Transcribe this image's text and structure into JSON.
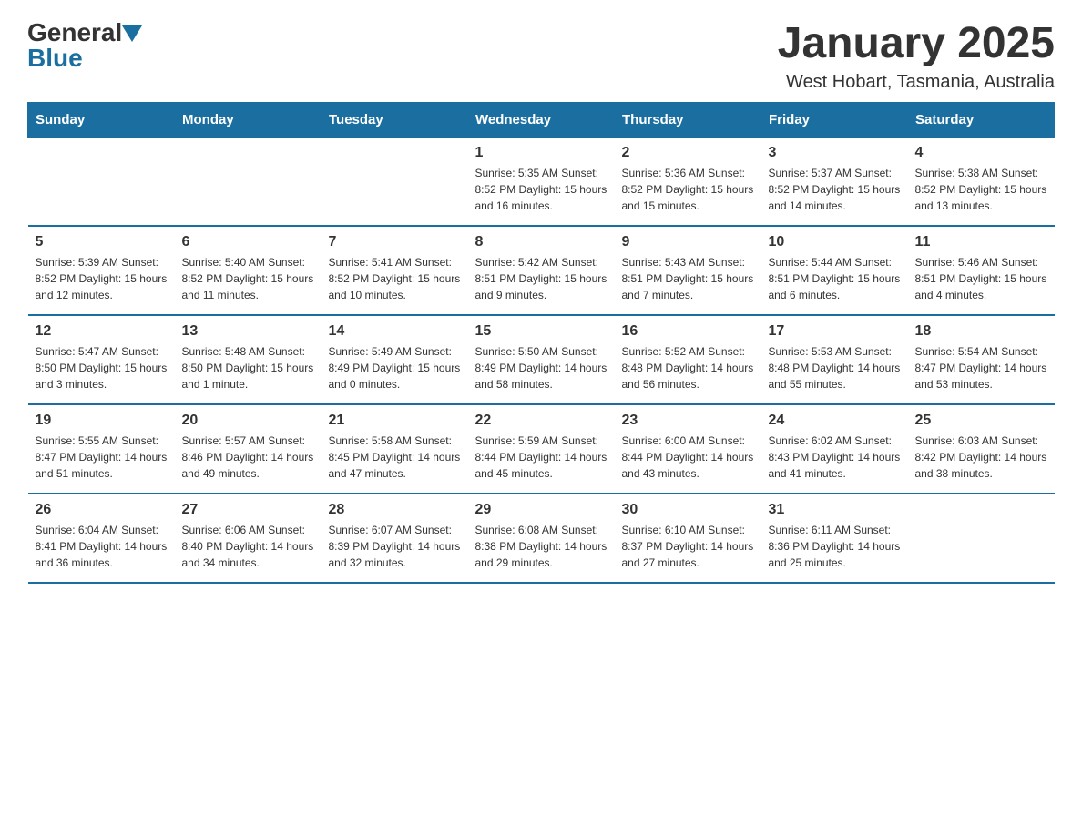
{
  "logo": {
    "general": "General",
    "blue": "Blue"
  },
  "title": "January 2025",
  "location": "West Hobart, Tasmania, Australia",
  "days_of_week": [
    "Sunday",
    "Monday",
    "Tuesday",
    "Wednesday",
    "Thursday",
    "Friday",
    "Saturday"
  ],
  "weeks": [
    [
      {
        "day": "",
        "info": ""
      },
      {
        "day": "",
        "info": ""
      },
      {
        "day": "",
        "info": ""
      },
      {
        "day": "1",
        "info": "Sunrise: 5:35 AM\nSunset: 8:52 PM\nDaylight: 15 hours and 16 minutes."
      },
      {
        "day": "2",
        "info": "Sunrise: 5:36 AM\nSunset: 8:52 PM\nDaylight: 15 hours and 15 minutes."
      },
      {
        "day": "3",
        "info": "Sunrise: 5:37 AM\nSunset: 8:52 PM\nDaylight: 15 hours and 14 minutes."
      },
      {
        "day": "4",
        "info": "Sunrise: 5:38 AM\nSunset: 8:52 PM\nDaylight: 15 hours and 13 minutes."
      }
    ],
    [
      {
        "day": "5",
        "info": "Sunrise: 5:39 AM\nSunset: 8:52 PM\nDaylight: 15 hours and 12 minutes."
      },
      {
        "day": "6",
        "info": "Sunrise: 5:40 AM\nSunset: 8:52 PM\nDaylight: 15 hours and 11 minutes."
      },
      {
        "day": "7",
        "info": "Sunrise: 5:41 AM\nSunset: 8:52 PM\nDaylight: 15 hours and 10 minutes."
      },
      {
        "day": "8",
        "info": "Sunrise: 5:42 AM\nSunset: 8:51 PM\nDaylight: 15 hours and 9 minutes."
      },
      {
        "day": "9",
        "info": "Sunrise: 5:43 AM\nSunset: 8:51 PM\nDaylight: 15 hours and 7 minutes."
      },
      {
        "day": "10",
        "info": "Sunrise: 5:44 AM\nSunset: 8:51 PM\nDaylight: 15 hours and 6 minutes."
      },
      {
        "day": "11",
        "info": "Sunrise: 5:46 AM\nSunset: 8:51 PM\nDaylight: 15 hours and 4 minutes."
      }
    ],
    [
      {
        "day": "12",
        "info": "Sunrise: 5:47 AM\nSunset: 8:50 PM\nDaylight: 15 hours and 3 minutes."
      },
      {
        "day": "13",
        "info": "Sunrise: 5:48 AM\nSunset: 8:50 PM\nDaylight: 15 hours and 1 minute."
      },
      {
        "day": "14",
        "info": "Sunrise: 5:49 AM\nSunset: 8:49 PM\nDaylight: 15 hours and 0 minutes."
      },
      {
        "day": "15",
        "info": "Sunrise: 5:50 AM\nSunset: 8:49 PM\nDaylight: 14 hours and 58 minutes."
      },
      {
        "day": "16",
        "info": "Sunrise: 5:52 AM\nSunset: 8:48 PM\nDaylight: 14 hours and 56 minutes."
      },
      {
        "day": "17",
        "info": "Sunrise: 5:53 AM\nSunset: 8:48 PM\nDaylight: 14 hours and 55 minutes."
      },
      {
        "day": "18",
        "info": "Sunrise: 5:54 AM\nSunset: 8:47 PM\nDaylight: 14 hours and 53 minutes."
      }
    ],
    [
      {
        "day": "19",
        "info": "Sunrise: 5:55 AM\nSunset: 8:47 PM\nDaylight: 14 hours and 51 minutes."
      },
      {
        "day": "20",
        "info": "Sunrise: 5:57 AM\nSunset: 8:46 PM\nDaylight: 14 hours and 49 minutes."
      },
      {
        "day": "21",
        "info": "Sunrise: 5:58 AM\nSunset: 8:45 PM\nDaylight: 14 hours and 47 minutes."
      },
      {
        "day": "22",
        "info": "Sunrise: 5:59 AM\nSunset: 8:44 PM\nDaylight: 14 hours and 45 minutes."
      },
      {
        "day": "23",
        "info": "Sunrise: 6:00 AM\nSunset: 8:44 PM\nDaylight: 14 hours and 43 minutes."
      },
      {
        "day": "24",
        "info": "Sunrise: 6:02 AM\nSunset: 8:43 PM\nDaylight: 14 hours and 41 minutes."
      },
      {
        "day": "25",
        "info": "Sunrise: 6:03 AM\nSunset: 8:42 PM\nDaylight: 14 hours and 38 minutes."
      }
    ],
    [
      {
        "day": "26",
        "info": "Sunrise: 6:04 AM\nSunset: 8:41 PM\nDaylight: 14 hours and 36 minutes."
      },
      {
        "day": "27",
        "info": "Sunrise: 6:06 AM\nSunset: 8:40 PM\nDaylight: 14 hours and 34 minutes."
      },
      {
        "day": "28",
        "info": "Sunrise: 6:07 AM\nSunset: 8:39 PM\nDaylight: 14 hours and 32 minutes."
      },
      {
        "day": "29",
        "info": "Sunrise: 6:08 AM\nSunset: 8:38 PM\nDaylight: 14 hours and 29 minutes."
      },
      {
        "day": "30",
        "info": "Sunrise: 6:10 AM\nSunset: 8:37 PM\nDaylight: 14 hours and 27 minutes."
      },
      {
        "day": "31",
        "info": "Sunrise: 6:11 AM\nSunset: 8:36 PM\nDaylight: 14 hours and 25 minutes."
      },
      {
        "day": "",
        "info": ""
      }
    ]
  ]
}
